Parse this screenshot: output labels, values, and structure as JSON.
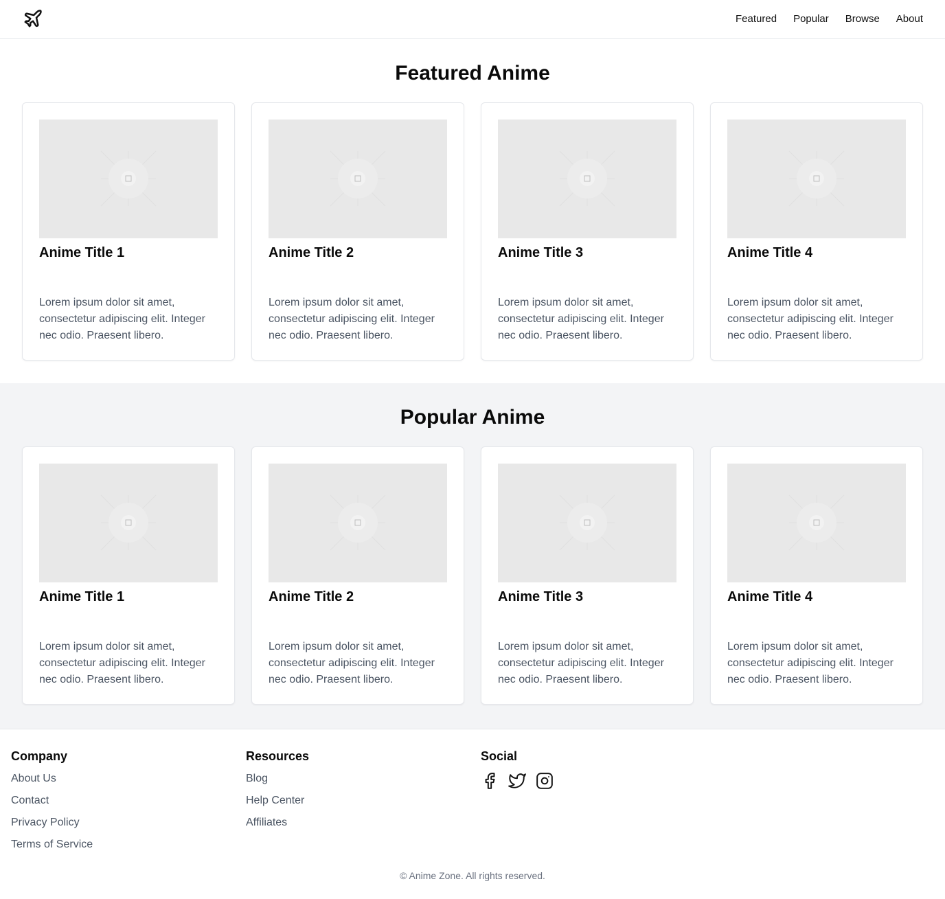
{
  "header": {
    "logo_icon": "plane-icon",
    "nav": [
      {
        "label": "Featured"
      },
      {
        "label": "Popular"
      },
      {
        "label": "Browse"
      },
      {
        "label": "About"
      }
    ]
  },
  "featured": {
    "title": "Featured Anime",
    "cards": [
      {
        "title": "Anime Title 1",
        "desc": "Lorem ipsum dolor sit amet, consectetur adipiscing elit. Integer nec odio. Praesent libero."
      },
      {
        "title": "Anime Title 2",
        "desc": "Lorem ipsum dolor sit amet, consectetur adipiscing elit. Integer nec odio. Praesent libero."
      },
      {
        "title": "Anime Title 3",
        "desc": "Lorem ipsum dolor sit amet, consectetur adipiscing elit. Integer nec odio. Praesent libero."
      },
      {
        "title": "Anime Title 4",
        "desc": "Lorem ipsum dolor sit amet, consectetur adipiscing elit. Integer nec odio. Praesent libero."
      }
    ]
  },
  "popular": {
    "title": "Popular Anime",
    "cards": [
      {
        "title": "Anime Title 1",
        "desc": "Lorem ipsum dolor sit amet, consectetur adipiscing elit. Integer nec odio. Praesent libero."
      },
      {
        "title": "Anime Title 2",
        "desc": "Lorem ipsum dolor sit amet, consectetur adipiscing elit. Integer nec odio. Praesent libero."
      },
      {
        "title": "Anime Title 3",
        "desc": "Lorem ipsum dolor sit amet, consectetur adipiscing elit. Integer nec odio. Praesent libero."
      },
      {
        "title": "Anime Title 4",
        "desc": "Lorem ipsum dolor sit amet, consectetur adipiscing elit. Integer nec odio. Praesent libero."
      }
    ]
  },
  "footer": {
    "company": {
      "heading": "Company",
      "links": [
        "About Us",
        "Contact",
        "Privacy Policy",
        "Terms of Service"
      ]
    },
    "resources": {
      "heading": "Resources",
      "links": [
        "Blog",
        "Help Center",
        "Affiliates"
      ]
    },
    "social": {
      "heading": "Social",
      "icons": [
        "facebook-icon",
        "twitter-icon",
        "instagram-icon"
      ]
    },
    "copyright": "© Anime Zone. All rights reserved."
  },
  "colors": {
    "accent_text": "#111111",
    "muted_text": "#4b5563",
    "placeholder_bg": "#e8e8e8",
    "section_alt_bg": "#f3f4f6"
  }
}
